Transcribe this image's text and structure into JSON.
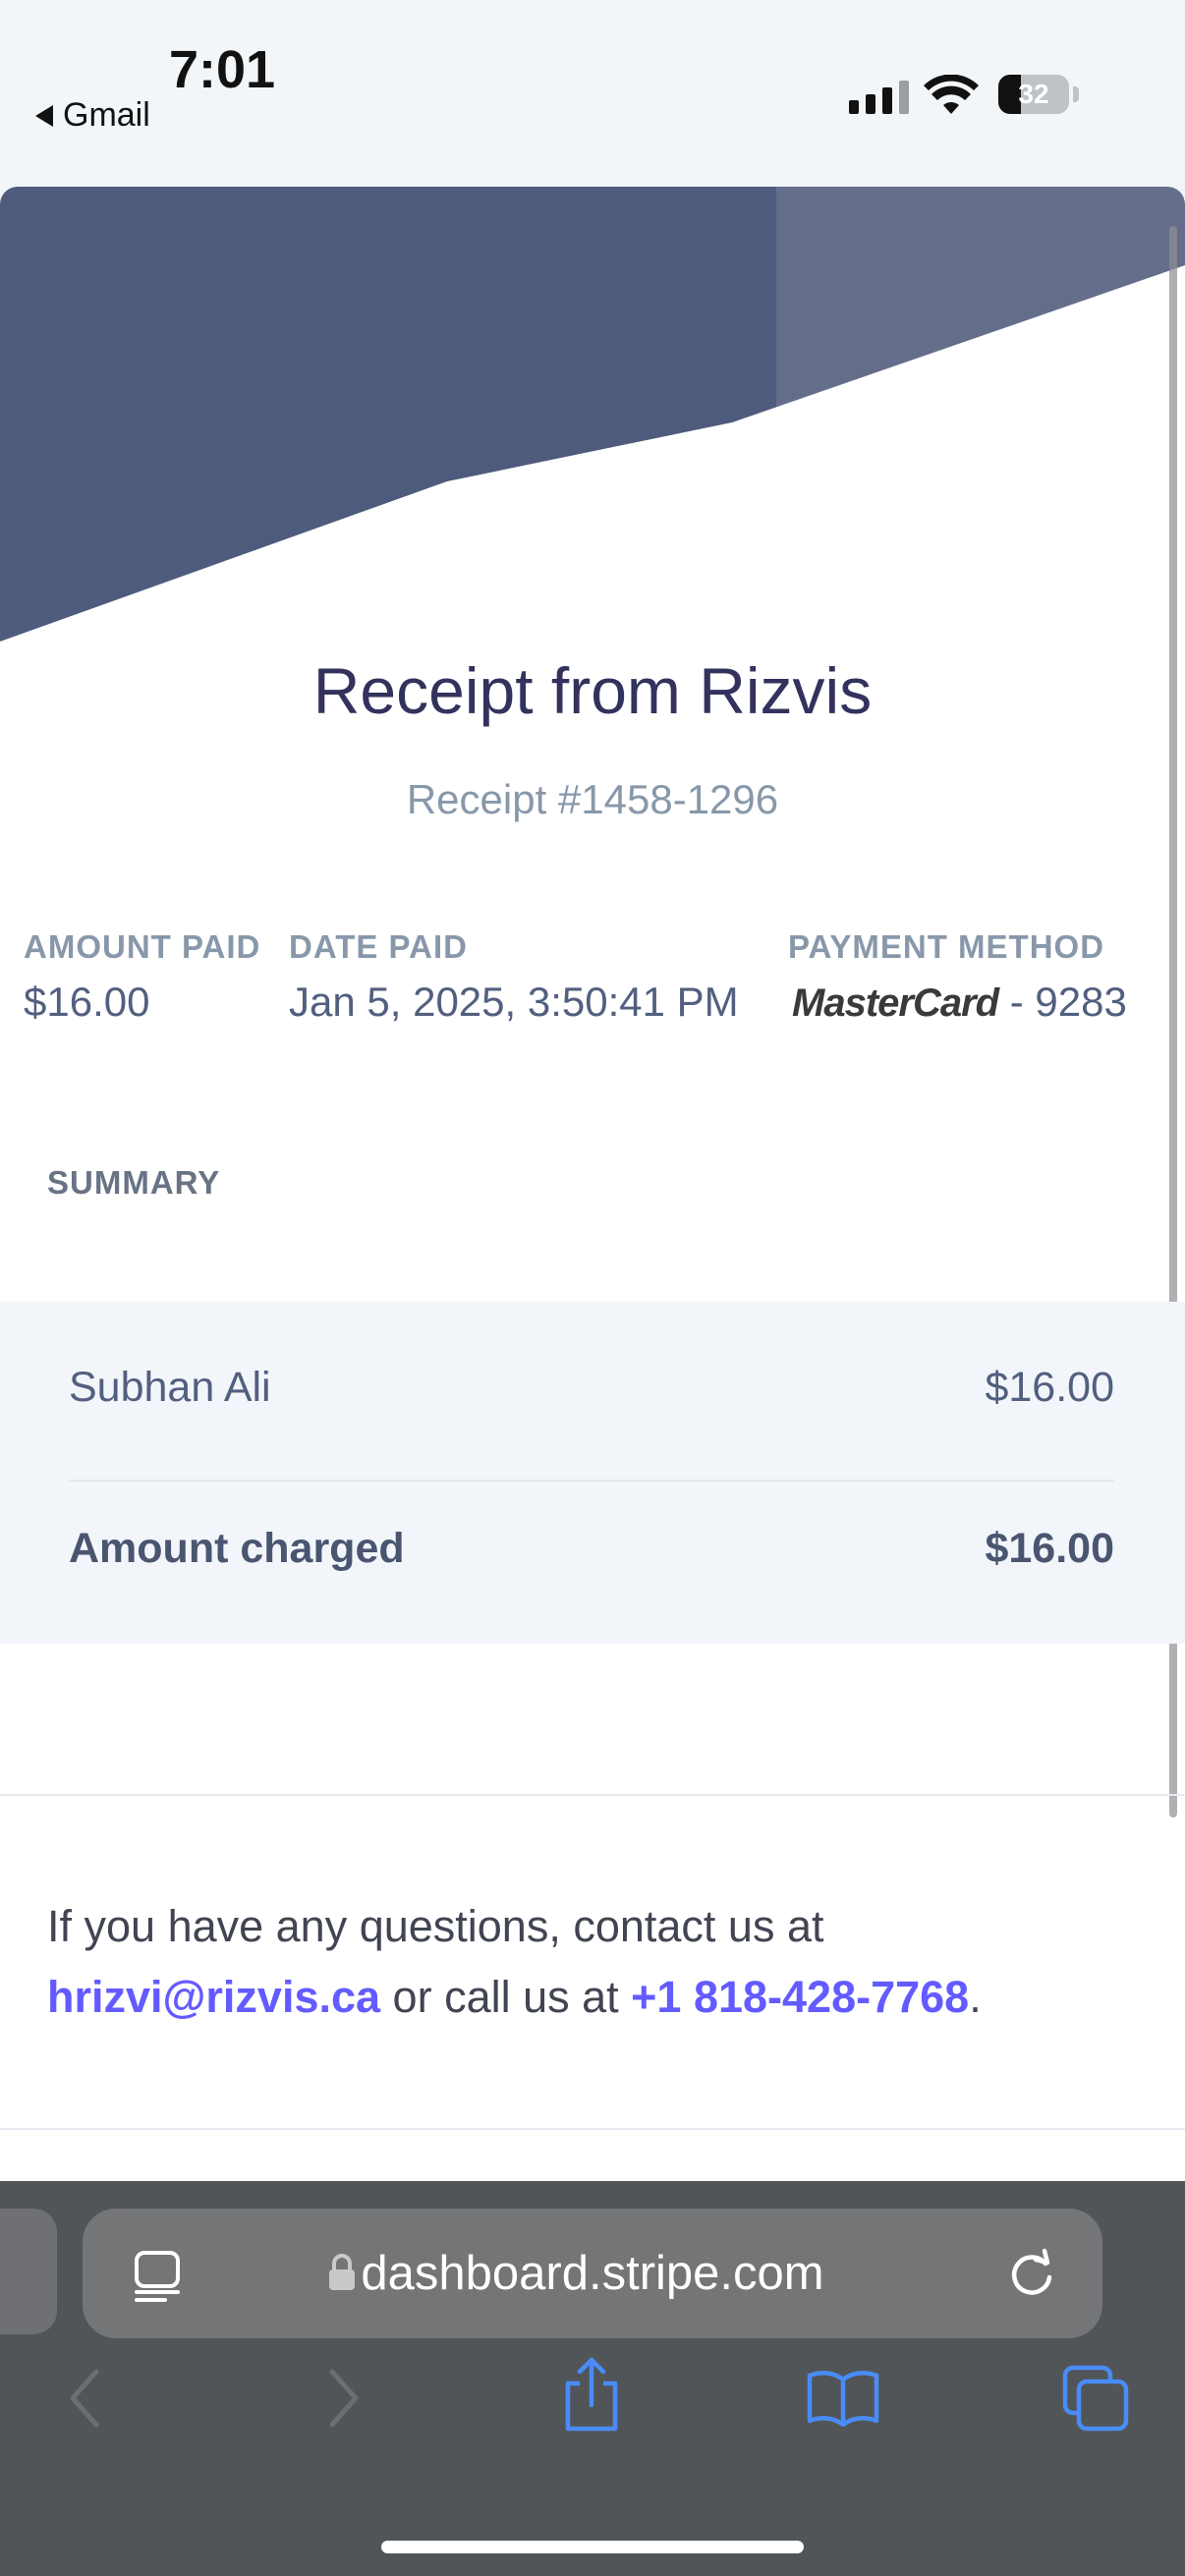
{
  "status_bar": {
    "time": "7:01",
    "back_app": "Gmail",
    "battery": "32",
    "battery_level": 0.32
  },
  "receipt": {
    "title": "Receipt from Rizvis",
    "number": "Receipt #1458-1296",
    "amount_paid_label": "AMOUNT PAID",
    "amount_paid": "$16.00",
    "date_paid_label": "DATE PAID",
    "date_paid": "Jan 5, 2025, 3:50:41 PM",
    "payment_method_label": "PAYMENT METHOD",
    "card_brand": "MasterCard",
    "card_last4": "- 9283"
  },
  "summary": {
    "label": "SUMMARY",
    "item_name": "Subhan Ali",
    "item_amount": "$16.00",
    "total_label": "Amount charged",
    "total_amount": "$16.00"
  },
  "contact": {
    "intro": "If you have any questions, contact us at",
    "email": "hrizvi@rizvis.ca",
    "middle": " or call us at ",
    "phone": "+1 818-428-7768",
    "end": "."
  },
  "browser": {
    "url": "dashboard.stripe.com"
  },
  "colors": {
    "header_band": "#4f5b7c",
    "link": "#635bff",
    "heading": "#32325d",
    "toolbar_icon": "#4a8cf7"
  },
  "icons": [
    "back-triangle-icon",
    "cellular-signal-icon",
    "wifi-icon",
    "battery-icon",
    "reader-mode-icon",
    "lock-icon",
    "reload-icon",
    "back-icon",
    "forward-icon",
    "share-icon",
    "bookmarks-icon",
    "tabs-icon"
  ]
}
